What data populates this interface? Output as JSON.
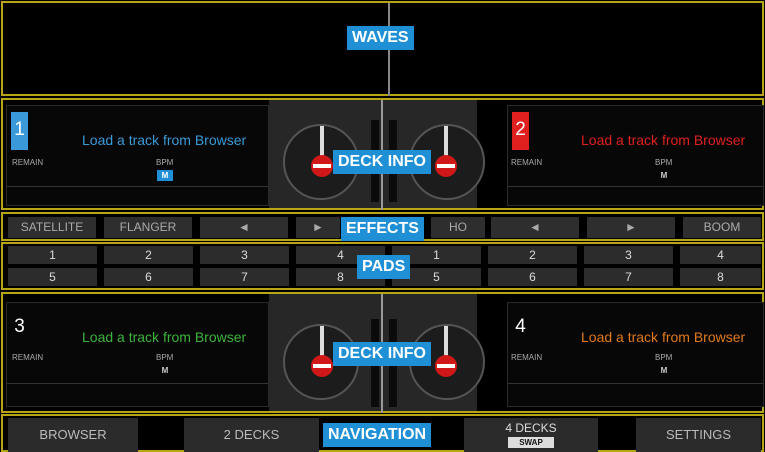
{
  "callouts": {
    "waves": "WAVES",
    "deck_info": "DECK INFO",
    "effects": "EFFECTS",
    "pads": "PADS",
    "navigation": "NAVIGATION"
  },
  "decks": [
    {
      "number": "1",
      "load": "Load a track from Browser",
      "remain": "REMAIN",
      "bpm": "BPM",
      "m": "M",
      "color": "#3a9ad9"
    },
    {
      "number": "2",
      "load": "Load a track from Browser",
      "remain": "REMAIN",
      "bpm": "BPM",
      "m": "M",
      "color": "#e0201f"
    },
    {
      "number": "3",
      "load": "Load a track from Browser",
      "remain": "REMAIN",
      "bpm": "BPM",
      "m": "M",
      "color": "#3cb43c"
    },
    {
      "number": "4",
      "load": "Load a track from Browser",
      "remain": "REMAIN",
      "bpm": "BPM",
      "m": "M",
      "color": "#e07a1c"
    }
  ],
  "effects": {
    "left": [
      "SATELLITE",
      "FLANGER",
      "◄",
      "►"
    ],
    "right": [
      "HO",
      "◄",
      "►",
      "BOOM"
    ]
  },
  "pads": {
    "left_row1": [
      "1",
      "2",
      "3",
      "4"
    ],
    "left_row2": [
      "5",
      "6",
      "7",
      "8"
    ],
    "right_row1": [
      "1",
      "2",
      "3",
      "4"
    ],
    "right_row2": [
      "5",
      "6",
      "7",
      "8"
    ]
  },
  "nav": {
    "browser": "BROWSER",
    "two_decks": "2 DECKS",
    "four_decks": "4 DECKS",
    "swap": "SWAP",
    "settings": "SETTINGS"
  },
  "colors": {
    "accent": "#1f8fd6",
    "zone_border": "#b8a516"
  }
}
